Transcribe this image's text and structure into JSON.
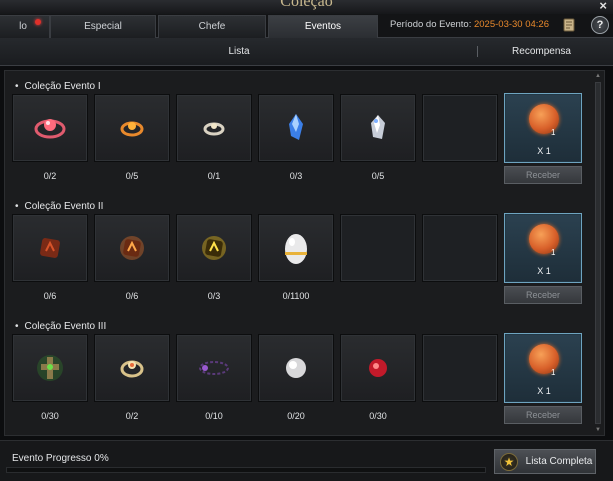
{
  "window": {
    "title": "Coleção"
  },
  "tabs": [
    {
      "label": "lo",
      "active": false,
      "dot": true
    },
    {
      "label": "Especial",
      "active": false,
      "dot": false
    },
    {
      "label": "Chefe",
      "active": false,
      "dot": false
    },
    {
      "label": "Eventos",
      "active": true,
      "dot": false
    }
  ],
  "event_period": {
    "label": "Período do Evento:",
    "value": "2025-03-30 04:26"
  },
  "header": {
    "list_label": "Lista",
    "reward_label": "Recompensa"
  },
  "sections": [
    {
      "title": "Coleção Evento I",
      "items": [
        {
          "icon": "red-gem-ring-icon",
          "count": "0/2"
        },
        {
          "icon": "orange-ring-icon",
          "count": "0/5"
        },
        {
          "icon": "silver-ring-icon",
          "count": "0/1"
        },
        {
          "icon": "blue-crystal-icon",
          "count": "0/3"
        },
        {
          "icon": "white-crystal-icon",
          "count": "0/5"
        }
      ],
      "reward": {
        "icon": "orange-orb-icon",
        "quantity": "X 1",
        "badge": "1",
        "button_label": "Receber"
      }
    },
    {
      "title": "Coleção Evento II",
      "items": [
        {
          "icon": "dark-red-rune-icon",
          "count": "0/6"
        },
        {
          "icon": "orange-rune-icon",
          "count": "0/6"
        },
        {
          "icon": "yellow-rune-icon",
          "count": "0/3"
        },
        {
          "icon": "egg-icon",
          "count": "0/1100"
        }
      ],
      "reward": {
        "icon": "orange-orb-icon",
        "quantity": "X 1",
        "badge": "1",
        "button_label": "Receber"
      }
    },
    {
      "title": "Coleção Evento III",
      "items": [
        {
          "icon": "green-cross-icon",
          "count": "0/30"
        },
        {
          "icon": "gold-ring-icon",
          "count": "0/2"
        },
        {
          "icon": "purple-bracelet-icon",
          "count": "0/10"
        },
        {
          "icon": "white-orb-icon",
          "count": "0/20"
        },
        {
          "icon": "red-gem-icon",
          "count": "0/30"
        }
      ],
      "reward": {
        "icon": "orange-orb-icon",
        "quantity": "X 1",
        "badge": "1",
        "button_label": "Receber"
      }
    }
  ],
  "footer": {
    "progress_label": "Evento Progresso 0%",
    "progress_value": 0,
    "full_list_button": "Lista Completa"
  },
  "colors": {
    "accent_orange": "#e8892c",
    "reward_border": "#6ea4c0",
    "notification_red": "#e0302a"
  }
}
